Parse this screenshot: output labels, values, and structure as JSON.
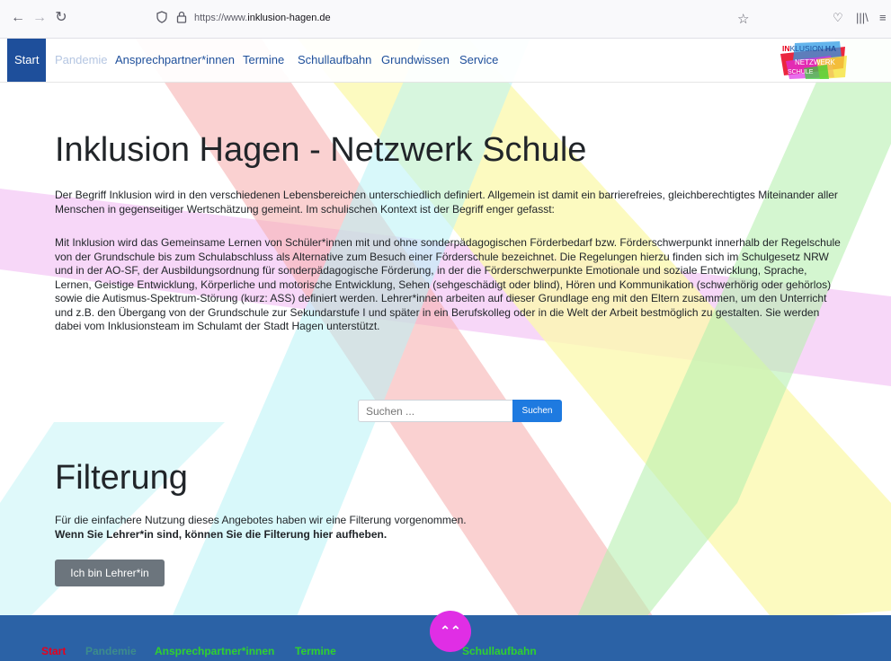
{
  "browser": {
    "back_icon": "arrow-left-icon",
    "forward_icon": "arrow-right-icon",
    "reload_icon": "reload-icon",
    "url_prefix": "https://www.",
    "url_domain": "inklusion-hagen.de"
  },
  "nav": {
    "items": [
      {
        "label": "Start"
      },
      {
        "label": "Pandemie"
      },
      {
        "label": "Ansprechpartner*innen"
      },
      {
        "label": "Termine"
      },
      {
        "label": "Schullaufbahn"
      },
      {
        "label": "Grundwissen"
      },
      {
        "label": "Service"
      }
    ],
    "active_color": "#1e4f9b",
    "logo": {
      "line1_in": "IN",
      "line1_rest": "KLUSION",
      "line1_ha": "HA",
      "line2": "NETZWERK",
      "line3": "SCHULE"
    }
  },
  "main": {
    "title": "Inklusion Hagen - Netzwerk Schule",
    "intro": "Der Begriff Inklusion wird in den verschiedenen Lebensbereichen unterschiedlich definiert. Allgemein ist damit ein barrierefreies, gleichberechtigtes Miteinander aller Menschen in gegenseitiger Wertschätzung gemeint. Im schulischen Kontext ist der Begriff enger gefasst:",
    "body": "Mit Inklusion wird das Gemeinsame Lernen von Schüler*innen mit und ohne sonderpädagogischen Förderbedarf bzw. Förderschwerpunkt innerhalb der Regelschule von der Grundschule bis zum Schulabschluss als Alternative zum Besuch einer Förderschule bezeichnet. Die Regelungen hierzu finden sich im Schulgesetz NRW und in der AO-SF, der Ausbildungsordnung für sonderpädagogische Förderung, in der die Förderschwerpunkte Emotionale und soziale Entwicklung, Sprache, Lernen, Geistige Entwicklung, Körperliche und motorische Entwicklung, Sehen (sehgeschädigt oder blind), Hören und Kommunikation (schwerhörig oder gehörlos) sowie die Autismus-Spektrum-Störung (kurz: ASS) definiert werden. Lehrer*innen arbeiten auf dieser Grundlage eng mit den Eltern zusammen, um den Unterricht und z.B. den Übergang von der Grundschule zur Sekundarstufe I und später in ein Berufskolleg oder in die Welt der Arbeit bestmöglich zu gestalten. Sie werden dabei vom Inklusionsteam im Schulamt der Stadt Hagen unterstützt."
  },
  "search": {
    "placeholder": "Suchen ...",
    "button_label": "Suchen"
  },
  "filter": {
    "title": "Filterung",
    "text": "Für die einfachere Nutzung dieses Angebotes haben wir eine Filterung vorgenommen.",
    "bold_text": "Wenn Sie Lehrer*in sind, können Sie die Filterung hier aufheben.",
    "button_label": "Ich bin Lehrer*in"
  },
  "footer": {
    "links": [
      {
        "label": "Start",
        "color": "#e8001c"
      },
      {
        "label": "Pandemie",
        "color": "#3c8c8c"
      },
      {
        "label": "Ansprechpartner*innen",
        "color": "#2fd12f"
      },
      {
        "label": "Termine",
        "color": "#2fd12f"
      },
      {
        "label": "Schullaufbahn",
        "color": "#2fd12f"
      }
    ],
    "background": "#2b62a6"
  },
  "scroll_top": {
    "icon": "double-chevron-up-icon",
    "color": "#e02ee5"
  }
}
